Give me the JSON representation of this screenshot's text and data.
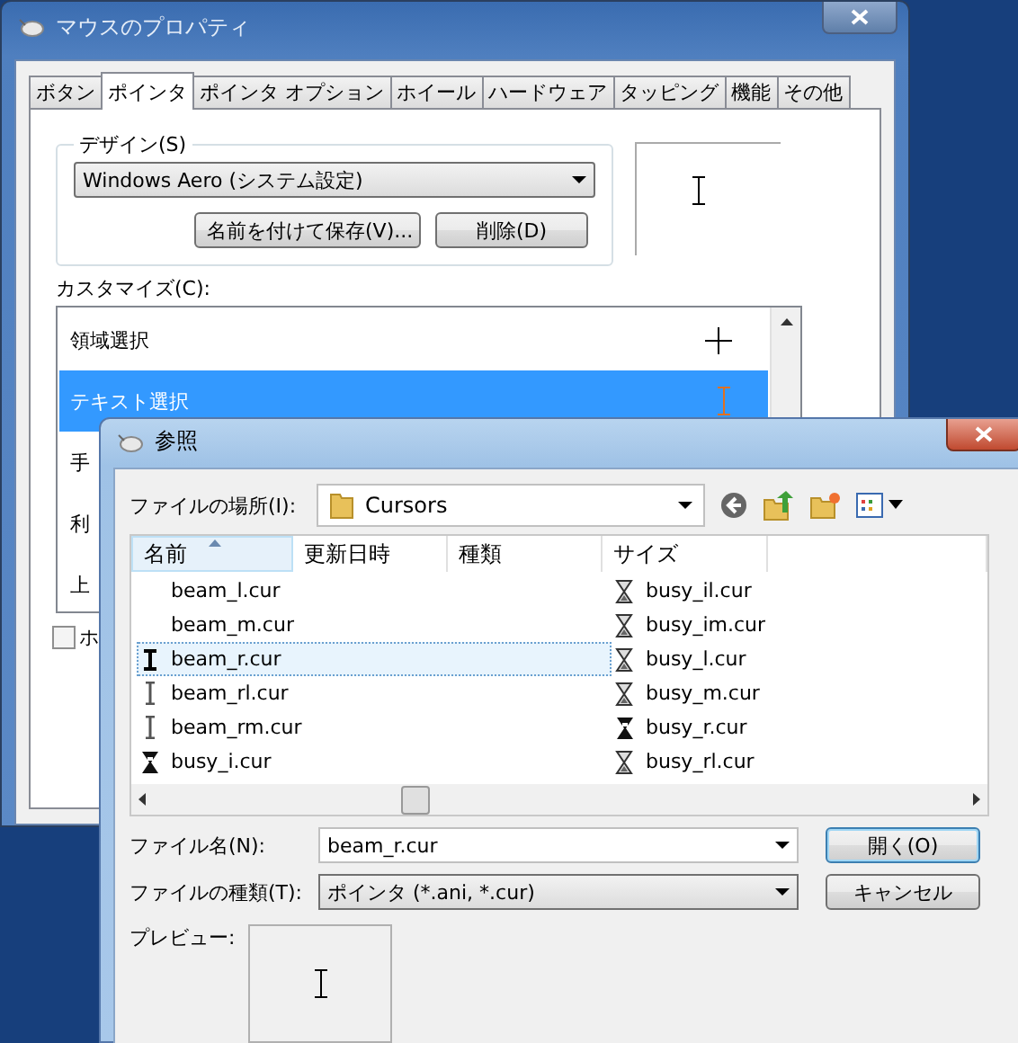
{
  "properties_window": {
    "title": "マウスのプロパティ",
    "tabs": [
      {
        "label": "ボタン",
        "selected": false
      },
      {
        "label": "ポインタ",
        "selected": true
      },
      {
        "label": "ポインタ オプション",
        "selected": false
      },
      {
        "label": "ホイール",
        "selected": false
      },
      {
        "label": "ハードウェア",
        "selected": false
      },
      {
        "label": "タッピング",
        "selected": false
      },
      {
        "label": "機能",
        "selected": false
      },
      {
        "label": "その他",
        "selected": false
      }
    ],
    "design": {
      "label": "デザイン(S)",
      "scheme": "Windows Aero (システム設定)",
      "buttons": [
        "名前を付けて保存(V)...",
        "削除(D)"
      ]
    },
    "customize": {
      "label": "カスタマイズ(C):",
      "items": [
        {
          "label": "領域選択",
          "kind": "cross",
          "selected": false
        },
        {
          "label": "テキスト選択",
          "kind": "beam",
          "selected": true
        },
        {
          "label": "手",
          "kind": "plain",
          "selected": false
        },
        {
          "label": "利",
          "kind": "plain",
          "selected": false
        },
        {
          "label": "上",
          "kind": "plain",
          "selected": false
        }
      ]
    },
    "checkbox": {
      "label": "ホ",
      "checked": false
    }
  },
  "browse_dialog": {
    "title": "参照",
    "location_label": "ファイルの場所(I):",
    "location": "Cursors",
    "columns": [
      {
        "label": "名前",
        "sorted": true
      },
      {
        "label": "更新日時",
        "sorted": false
      },
      {
        "label": "種類",
        "sorted": false
      },
      {
        "label": "サイズ",
        "sorted": false
      }
    ],
    "files": [
      {
        "name": "beam_l.cur",
        "kind": "plain",
        "selected": false
      },
      {
        "name": "beam_m.cur",
        "kind": "plain",
        "selected": false
      },
      {
        "name": "beam_r.cur",
        "kind": "boldbeam",
        "selected": true
      },
      {
        "name": "beam_rl.cur",
        "kind": "beam",
        "selected": false
      },
      {
        "name": "beam_rm.cur",
        "kind": "beam",
        "selected": false
      },
      {
        "name": "busy_i.cur",
        "kind": "solidglass",
        "selected": false
      },
      {
        "name": "busy_il.cur",
        "kind": "glass",
        "selected": false
      },
      {
        "name": "busy_im.cur",
        "kind": "glass",
        "selected": false
      },
      {
        "name": "busy_l.cur",
        "kind": "glass",
        "selected": false
      },
      {
        "name": "busy_m.cur",
        "kind": "glass",
        "selected": false
      },
      {
        "name": "busy_r.cur",
        "kind": "solidglass",
        "selected": false
      },
      {
        "name": "busy_rl.cur",
        "kind": "glass",
        "selected": false
      }
    ],
    "filename_label": "ファイル名(N):",
    "filename": "beam_r.cur",
    "filetype_label": "ファイルの種類(T):",
    "filetype": "ポインタ (*.ani, *.cur)",
    "open_button": "開く(O)",
    "cancel_button": "キャンセル",
    "preview_label": "プレビュー:"
  }
}
